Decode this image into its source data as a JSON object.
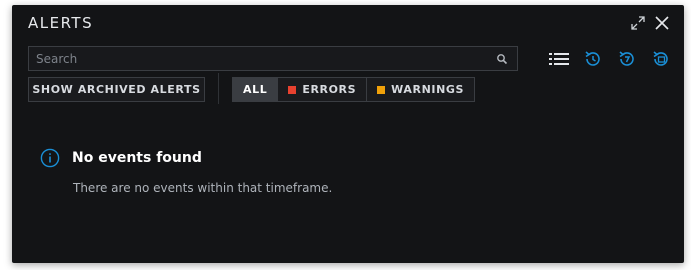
{
  "window": {
    "title": "ALERTS"
  },
  "search": {
    "placeholder": "Search",
    "value": ""
  },
  "actions": {
    "show_archived_label": "SHOW ARCHIVED ALERTS"
  },
  "filters": [
    {
      "label": "ALL",
      "active": true
    },
    {
      "label": "ERRORS",
      "color": "#e8412f"
    },
    {
      "label": "WARNINGS",
      "color": "#f0a10a"
    }
  ],
  "toolbar_icons": [
    "list-icon",
    "history-icon",
    "clock-icon",
    "calendar-history-icon"
  ],
  "empty_state": {
    "title": "No events found",
    "message": "There are no events within that timeframe."
  },
  "colors": {
    "accent": "#1a8fd6",
    "background": "#131416"
  }
}
